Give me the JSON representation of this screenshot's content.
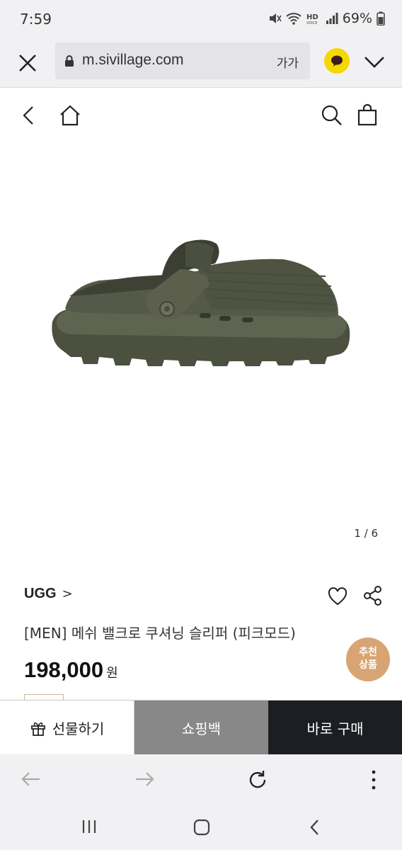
{
  "status_bar": {
    "time": "7:59",
    "battery": "69%"
  },
  "browser": {
    "url": "m.sivillage.com",
    "text_size_label": "가가"
  },
  "gallery": {
    "counter": "1 / 6"
  },
  "product": {
    "brand": "UGG",
    "brand_chevron": ">",
    "name": "[MEN] 메쉬 밸크로 쿠셔닝 슬리퍼 (피크모드)",
    "price": "198,000",
    "currency": "원",
    "recommend_badge_line1": "추천",
    "recommend_badge_line2": "상품"
  },
  "actions": {
    "gift": "선물하기",
    "cart": "쇼핑백",
    "buy": "바로 구매"
  },
  "colors": {
    "accent_badge": "#d8a473",
    "buy_button": "#1d1e24",
    "cart_button": "#888888",
    "kakao": "#f5d800"
  },
  "icons": [
    "close-icon",
    "lock-icon",
    "kakao-icon",
    "chevron-down-icon",
    "back-icon",
    "home-icon",
    "search-icon",
    "shopping-bag-icon",
    "heart-icon",
    "share-icon",
    "gift-icon",
    "arrow-left-icon",
    "arrow-right-icon",
    "reload-icon",
    "more-icon",
    "recent-apps-icon",
    "home-button-icon",
    "system-back-icon"
  ]
}
